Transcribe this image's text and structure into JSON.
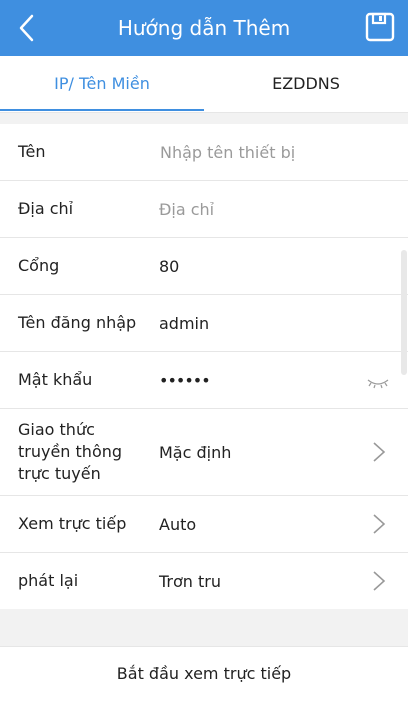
{
  "header": {
    "title": "Hướng dẫn Thêm",
    "back_icon": "back-arrow-icon",
    "save_icon": "save-icon",
    "color": "#3f8fe0"
  },
  "tabs": [
    {
      "label": "IP/ Tên Miền",
      "active": true
    },
    {
      "label": "EZDDNS",
      "active": false
    }
  ],
  "form": {
    "name": {
      "label": "Tên",
      "placeholder": "Nhập tên thiết bị",
      "value": ""
    },
    "address": {
      "label": "Địa chỉ",
      "placeholder": "Địa chỉ",
      "value": ""
    },
    "port": {
      "label": "Cổng",
      "value": "80"
    },
    "username": {
      "label": "Tên đăng nhập",
      "value": "admin"
    },
    "password": {
      "label": "Mật khẩu",
      "value": "••••••"
    },
    "protocol": {
      "label": "Giao thức truyền thông trực tuyến",
      "value": "Mặc định"
    },
    "live_view": {
      "label": "Xem trực tiếp",
      "value": "Auto"
    },
    "playback": {
      "label": "phát lại",
      "value": "Trơn tru"
    }
  },
  "start_button": {
    "label": "Bắt đầu xem trực tiếp"
  }
}
